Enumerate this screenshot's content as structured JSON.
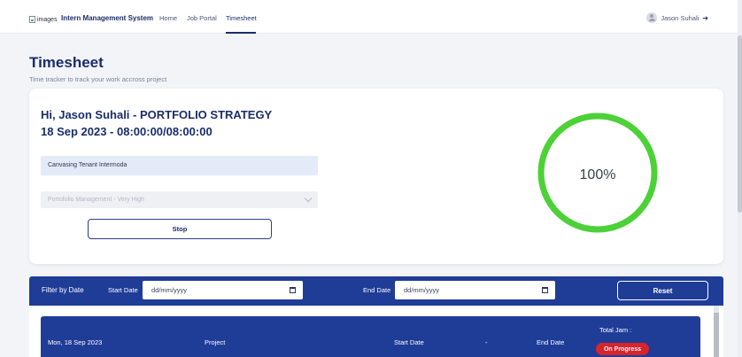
{
  "nav": {
    "brand_img_alt": "images",
    "brand_name": "Intern Management System",
    "links": [
      "Home",
      "Job Portal",
      "Timesheet"
    ],
    "active_link": "Timesheet",
    "user_name": "Jason Suhali"
  },
  "page": {
    "title": "Timesheet",
    "subtitle": "Time tracker to track your work accross project"
  },
  "tracker": {
    "greeting": "Hi, Jason Suhali - PORTFOLIO STRATEGY",
    "date_time": "18 Sep 2023 - 08:00:00/08:00:00",
    "task": "Canvasing Tenant Intermoda",
    "project": "Portofolio Management - Very High",
    "stop_label": "Stop",
    "progress_label": "100%",
    "progress_value": 100,
    "progress_color": "#4cd137"
  },
  "filter": {
    "label": "Filter by Date",
    "start_label": "Start Date",
    "start_placeholder": "dd/mm/yyyy",
    "end_label": "End Date",
    "end_placeholder": "dd/mm/yyyy",
    "reset_label": "Reset"
  },
  "table": {
    "date": "Mon, 18 Sep 2023",
    "project_header": "Project",
    "start_header": "Start Date",
    "separator": "-",
    "end_header": "End Date",
    "total_header": "Total Jam :",
    "status": "On Progress",
    "status_color": "#d8242c"
  },
  "colors": {
    "primary": "#1f3c97",
    "heading": "#1a2d6b"
  }
}
